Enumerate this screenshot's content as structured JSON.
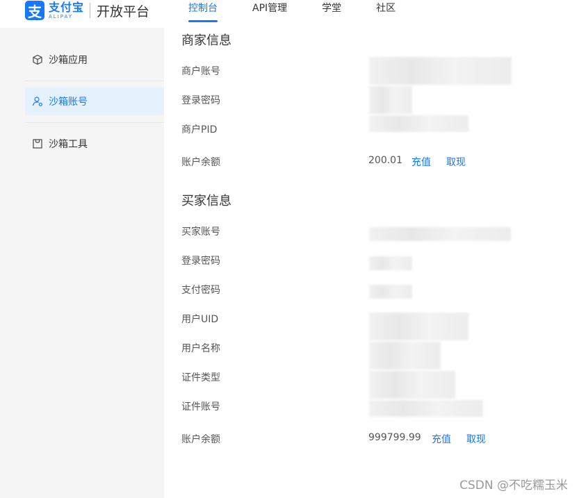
{
  "header": {
    "logo_mark": "支",
    "logo_cn": "支付宝",
    "logo_en": "ALIPAY",
    "title": "开放平台",
    "nav": [
      {
        "label": "控制台",
        "active": true
      },
      {
        "label": "API管理",
        "active": false
      },
      {
        "label": "学堂",
        "active": false
      },
      {
        "label": "社区",
        "active": false
      }
    ]
  },
  "sidebar": {
    "items": [
      {
        "label": "沙箱应用",
        "icon": "cube-icon"
      },
      {
        "label": "沙箱账号",
        "icon": "user-gear-icon",
        "active": true
      },
      {
        "label": "沙箱工具",
        "icon": "bag-icon"
      }
    ]
  },
  "merchant": {
    "title": "商家信息",
    "labels": [
      "商户账号",
      "登录密码",
      "商户PID",
      "账户余额"
    ],
    "balance": "200.01",
    "recharge": "充值",
    "withdraw": "取现"
  },
  "buyer": {
    "title": "买家信息",
    "labels": [
      "买家账号",
      "登录密码",
      "支付密码",
      "用户UID",
      "用户名称",
      "证件类型",
      "证件账号",
      "账户余额"
    ],
    "balance": "999799.99",
    "recharge": "充值",
    "withdraw": "取现"
  },
  "watermark": "CSDN @不吃糯玉米",
  "colors": {
    "accent": "#1677ff",
    "sidebar_bg": "#f5f5f5",
    "active_bg": "#e6f1fe"
  }
}
